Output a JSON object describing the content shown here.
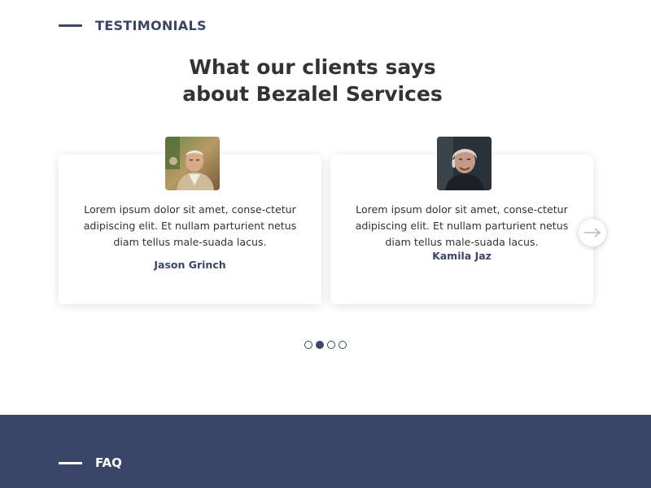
{
  "testimonials_section": {
    "eyebrow": "TESTIMONIALS",
    "heading_line1": "What our clients says",
    "heading_line2": "about Bezalel Services",
    "cards": [
      {
        "quote": "Lorem ipsum dolor sit amet, conse-ctetur adipiscing elit. Et nullam parturient netus diam tellus male-suada lacus.",
        "author": "Jason Grinch",
        "avatar": "elderly-man-photo"
      },
      {
        "quote": "Lorem ipsum dolor sit amet, conse-ctetur adipiscing elit. Et nullam parturient netus diam tellus male-suada lacus.",
        "author": "Kamila Jaz",
        "avatar": "elderly-woman-photo"
      }
    ],
    "next_icon": "arrow-right-icon",
    "pagination": {
      "count": 4,
      "active_index": 1
    }
  },
  "faq_section": {
    "eyebrow": "FAQ"
  },
  "colors": {
    "brand_navy": "#3a4667",
    "heading_text": "#333333",
    "background": "#ffffff"
  }
}
